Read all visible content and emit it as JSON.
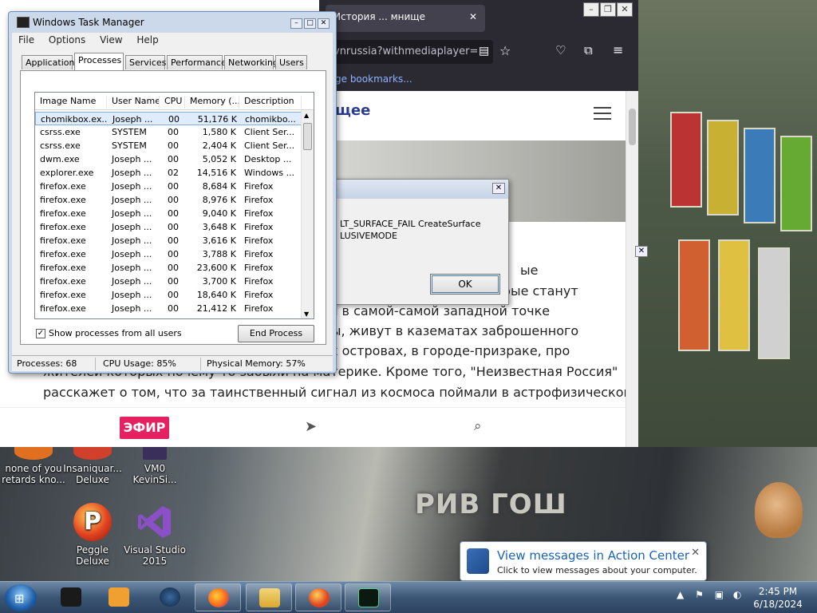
{
  "desktop": {
    "store_sign": "РИВ ГОШ",
    "icons": [
      {
        "label": "none of you retards kno..."
      },
      {
        "label": "Insaniquar... Deluxe"
      },
      {
        "label": "VM0 KevinSi..."
      },
      {
        "label": "Peggle Deluxe"
      },
      {
        "label": "Visual Studio 2015"
      }
    ]
  },
  "browser": {
    "tab_title": "История ... мнище",
    "url": "vnrussia?withmediaplayer=",
    "bookmarks_link": "ge bookmarks...",
    "site_logo": "щее",
    "article_lines": [
      "ые",
      "орые станут",
      "вал в самой-самой западной точке",
      "оды, живут в казематах заброшенного",
      "ких островах, в городе-призраке, про",
      "жителей которых почему-то забыли на материке. Кроме того, \"Неизвестная Россия\"",
      "расскажет о том, что за таинственный сигнал из космоса поймали в астрофизической"
    ],
    "efir_label": "ЭФИР"
  },
  "error_dialog": {
    "line1": "LT_SURFACE_FAIL CreateSurface",
    "line2": "LUSIVEMODE",
    "ok_label": "OK"
  },
  "task_manager": {
    "title": "Windows Task Manager",
    "menu": [
      "File",
      "Options",
      "View",
      "Help"
    ],
    "tabs": [
      "Applications",
      "Processes",
      "Services",
      "Performance",
      "Networking",
      "Users"
    ],
    "active_tab": "Processes",
    "columns": [
      "Image Name",
      "User Name",
      "CPU",
      "Memory (...",
      "Description"
    ],
    "rows": [
      {
        "image": "chomikbox.ex...",
        "user": "Joseph ...",
        "cpu": "00",
        "mem": "51,176 K",
        "desc": "chomikbo..."
      },
      {
        "image": "csrss.exe",
        "user": "SYSTEM",
        "cpu": "00",
        "mem": "1,580 K",
        "desc": "Client Ser..."
      },
      {
        "image": "csrss.exe",
        "user": "SYSTEM",
        "cpu": "00",
        "mem": "2,404 K",
        "desc": "Client Ser..."
      },
      {
        "image": "dwm.exe",
        "user": "Joseph ...",
        "cpu": "00",
        "mem": "5,052 K",
        "desc": "Desktop ..."
      },
      {
        "image": "explorer.exe",
        "user": "Joseph ...",
        "cpu": "02",
        "mem": "14,516 K",
        "desc": "Windows ..."
      },
      {
        "image": "firefox.exe",
        "user": "Joseph ...",
        "cpu": "00",
        "mem": "8,684 K",
        "desc": "Firefox"
      },
      {
        "image": "firefox.exe",
        "user": "Joseph ...",
        "cpu": "00",
        "mem": "8,976 K",
        "desc": "Firefox"
      },
      {
        "image": "firefox.exe",
        "user": "Joseph ...",
        "cpu": "00",
        "mem": "9,040 K",
        "desc": "Firefox"
      },
      {
        "image": "firefox.exe",
        "user": "Joseph ...",
        "cpu": "00",
        "mem": "3,648 K",
        "desc": "Firefox"
      },
      {
        "image": "firefox.exe",
        "user": "Joseph ...",
        "cpu": "00",
        "mem": "3,616 K",
        "desc": "Firefox"
      },
      {
        "image": "firefox.exe",
        "user": "Joseph ...",
        "cpu": "00",
        "mem": "3,788 K",
        "desc": "Firefox"
      },
      {
        "image": "firefox.exe",
        "user": "Joseph ...",
        "cpu": "00",
        "mem": "23,600 K",
        "desc": "Firefox"
      },
      {
        "image": "firefox.exe",
        "user": "Joseph ...",
        "cpu": "00",
        "mem": "3,700 K",
        "desc": "Firefox"
      },
      {
        "image": "firefox.exe",
        "user": "Joseph ...",
        "cpu": "00",
        "mem": "18,640 K",
        "desc": "Firefox"
      },
      {
        "image": "firefox.exe",
        "user": "Joseph ...",
        "cpu": "00",
        "mem": "21,412 K",
        "desc": "Firefox"
      }
    ],
    "show_all_label": "Show processes from all users",
    "show_all_checked": true,
    "end_process_label": "End Process",
    "status": {
      "processes": "Processes: 68",
      "cpu": "CPU Usage: 85%",
      "memory": "Physical Memory: 57%"
    }
  },
  "action_center": {
    "title": "View messages in Action Center",
    "subtitle": "Click to view messages about your computer."
  },
  "taskbar": {
    "time": "2:45 PM",
    "date": "6/18/2024"
  }
}
